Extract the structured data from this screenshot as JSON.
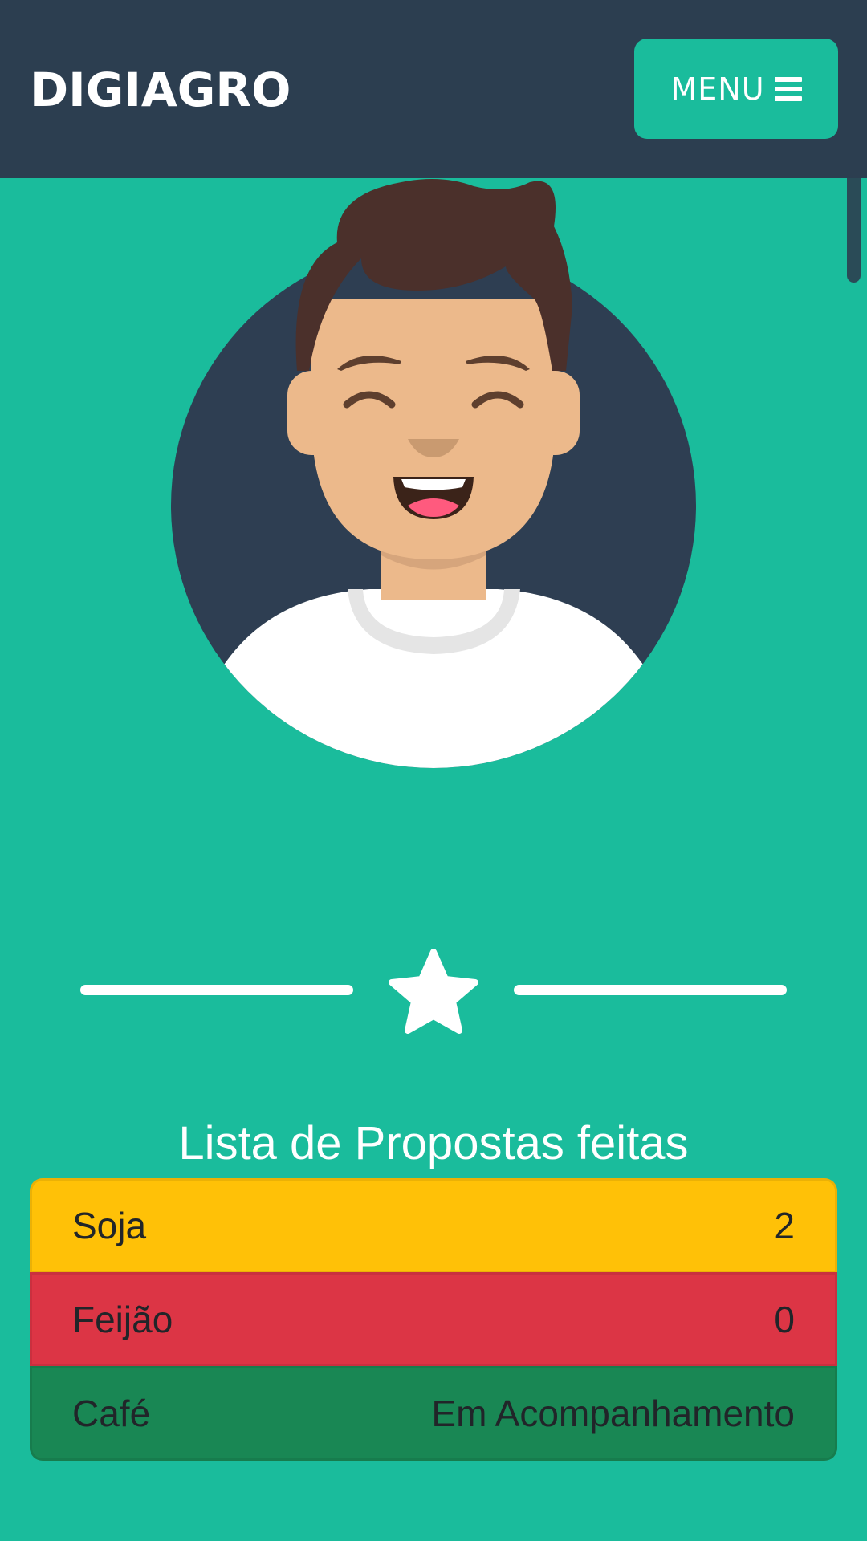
{
  "navbar": {
    "brand": "DIGIAGRO",
    "menu_label": "MENU",
    "menu_icon": "hamburger-icon",
    "background": "#2c3e50",
    "button_color": "#1abc9c"
  },
  "avatar": {
    "icon": "user-avatar-icon"
  },
  "divider": {
    "icon": "star-icon"
  },
  "proposals": {
    "title": "Lista de Propostas feitas",
    "items": [
      {
        "name": "Soja",
        "value": "2",
        "color": "#ffc107"
      },
      {
        "name": "Feijão",
        "value": "0",
        "color": "#dc3545"
      },
      {
        "name": "Café",
        "value": "Em Acompanhamento",
        "color": "#198754"
      }
    ]
  },
  "theme": {
    "page_background": "#1abc9c",
    "text_dark": "#212529"
  }
}
